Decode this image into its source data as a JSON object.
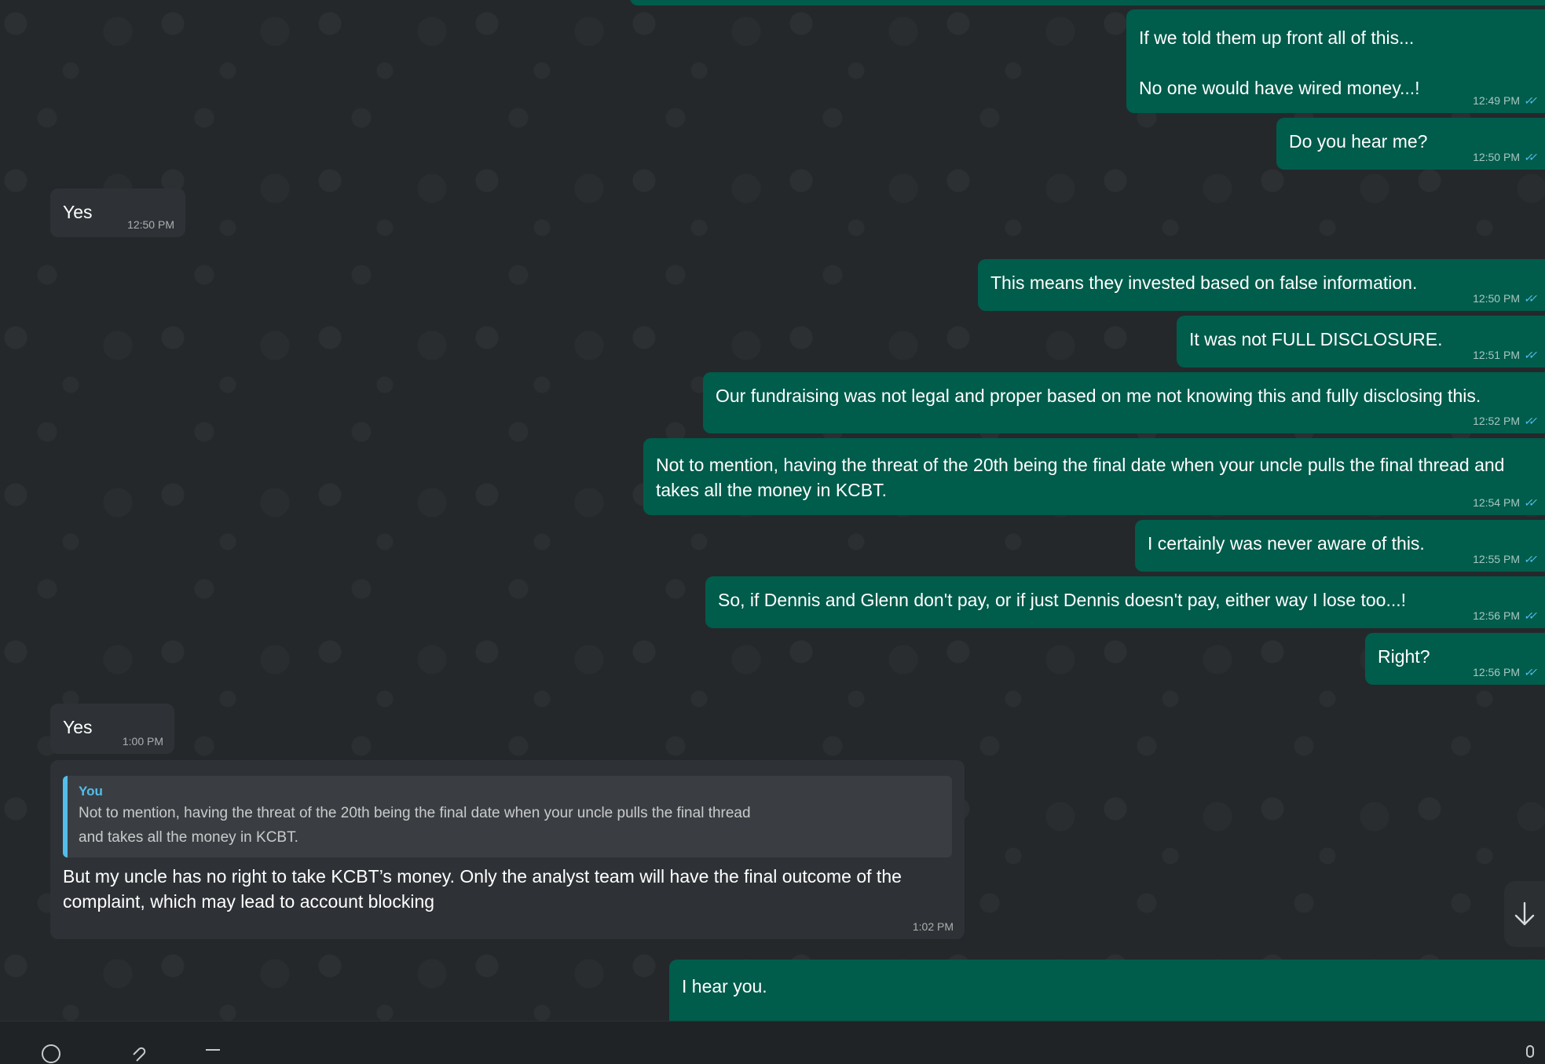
{
  "messages": [
    {
      "direction": "out",
      "text": "If we told them up front all of this...\n\nNo one would have wired money...!",
      "time": "12:49 PM",
      "status": "read"
    },
    {
      "direction": "out",
      "text": "Do you hear me?",
      "time": "12:50 PM",
      "status": "read"
    },
    {
      "direction": "in",
      "text": "Yes",
      "time": "12:50 PM"
    },
    {
      "direction": "out",
      "text": "This means they invested based on false information.",
      "time": "12:50 PM",
      "status": "read"
    },
    {
      "direction": "out",
      "text": "It was not FULL DISCLOSURE.",
      "time": "12:51 PM",
      "status": "read"
    },
    {
      "direction": "out",
      "text": "Our fundraising was not legal and proper based on me not knowing this and fully disclosing this.",
      "time": "12:52 PM",
      "status": "read"
    },
    {
      "direction": "out",
      "text": "Not to mention, having the threat of the 20th being the final date when your uncle pulls the final thread and takes all the money in KCBT.",
      "time": "12:54 PM",
      "status": "read"
    },
    {
      "direction": "out",
      "text": "I certainly was never aware of this.",
      "time": "12:55 PM",
      "status": "read"
    },
    {
      "direction": "out",
      "text": "So, if Dennis and Glenn don't pay, or if just Dennis doesn't pay, either way I lose too...!",
      "time": "12:56 PM",
      "status": "read"
    },
    {
      "direction": "out",
      "text": "Right?",
      "time": "12:56 PM",
      "status": "read"
    },
    {
      "direction": "in",
      "text": "Yes",
      "time": "1:00 PM"
    },
    {
      "direction": "in",
      "quote": {
        "author": "You",
        "text": "Not to mention, having the threat of the 20th being the final date when your uncle pulls the final thread and takes all the money in KCBT."
      },
      "text": "But my uncle has no right to take KCBT’s money. Only the analyst team will have the final outcome of the complaint, which may lead to account blocking",
      "time": "1:02 PM"
    },
    {
      "direction": "out",
      "text": "I hear you.",
      "time": "",
      "status": ""
    }
  ],
  "icons": {
    "scroll_down": "arrow-down-icon",
    "read_receipt": "double-check-icon",
    "footer": [
      "emoji-icon",
      "attach-icon",
      "menu-icon",
      "mic-icon"
    ]
  },
  "colors": {
    "outgoing_bubble": "#005c4b",
    "incoming_bubble": "#2e3236",
    "quote_accent": "#53bdeb",
    "read_tick": "#53bdeb",
    "chat_background": "#24282b"
  }
}
